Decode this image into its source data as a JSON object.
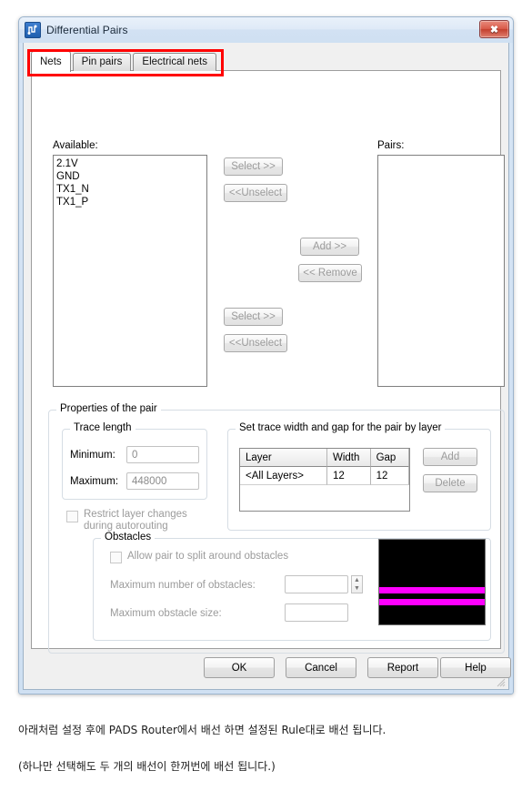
{
  "window": {
    "title": "Differential Pairs",
    "icon": "differential-pairs-icon",
    "close_label": "✖"
  },
  "tabs": [
    {
      "id": "nets",
      "label": "Nets",
      "active": true
    },
    {
      "id": "pin-pairs",
      "label": "Pin pairs",
      "active": false
    },
    {
      "id": "electrical-nets",
      "label": "Electrical nets",
      "active": false
    }
  ],
  "nets_tab": {
    "available_label": "Available:",
    "available_items": [
      "2.1V",
      "GND",
      "TX1_N",
      "TX1_P"
    ],
    "pairs_label": "Pairs:",
    "pairs_items": [],
    "buttons": {
      "select_top": "Select >>",
      "unselect_top": "<<Unselect",
      "add": "Add >>",
      "remove": "<< Remove",
      "select_bottom": "Select >>",
      "unselect_bottom": "<<Unselect"
    }
  },
  "properties": {
    "group_title": "Properties of the pair",
    "trace_length": {
      "group_title": "Trace length",
      "minimum_label": "Minimum:",
      "minimum_value": "0",
      "maximum_label": "Maximum:",
      "maximum_value": "448000"
    },
    "restrict_checkbox": {
      "line1": "Restrict layer changes",
      "line2": "during autorouting",
      "checked": false
    },
    "trace_width": {
      "group_title": "Set trace width and gap for the pair by layer",
      "columns": [
        "Layer",
        "Width",
        "Gap",
        ""
      ],
      "rows": [
        {
          "layer": "<All Layers>",
          "width": "12",
          "gap": "12",
          "extra": ""
        }
      ],
      "add_button": "Add",
      "delete_button": "Delete"
    },
    "obstacles": {
      "group_title": "Obstacles",
      "allow_split_label": "Allow pair to split around obstacles",
      "allow_split_checked": false,
      "max_number_label": "Maximum number of obstacles:",
      "max_number_value": "",
      "max_size_label": "Maximum obstacle size:",
      "max_size_value": "",
      "preview": {
        "background_color": "#000000",
        "trace_color": "#ff00ff"
      }
    }
  },
  "footer": {
    "ok": "OK",
    "cancel": "Cancel",
    "report": "Report",
    "help": "Help"
  },
  "annotation": {
    "highlight_color": "#ff0000"
  },
  "caption": {
    "line1": "아래처럼 설정 후에 PADS Router에서 배선 하면 설정된 Rule대로 배선 됩니다.",
    "line2": "(하나만 선택해도 두 개의 배선이 한꺼번에 배선 됩니다.)"
  }
}
